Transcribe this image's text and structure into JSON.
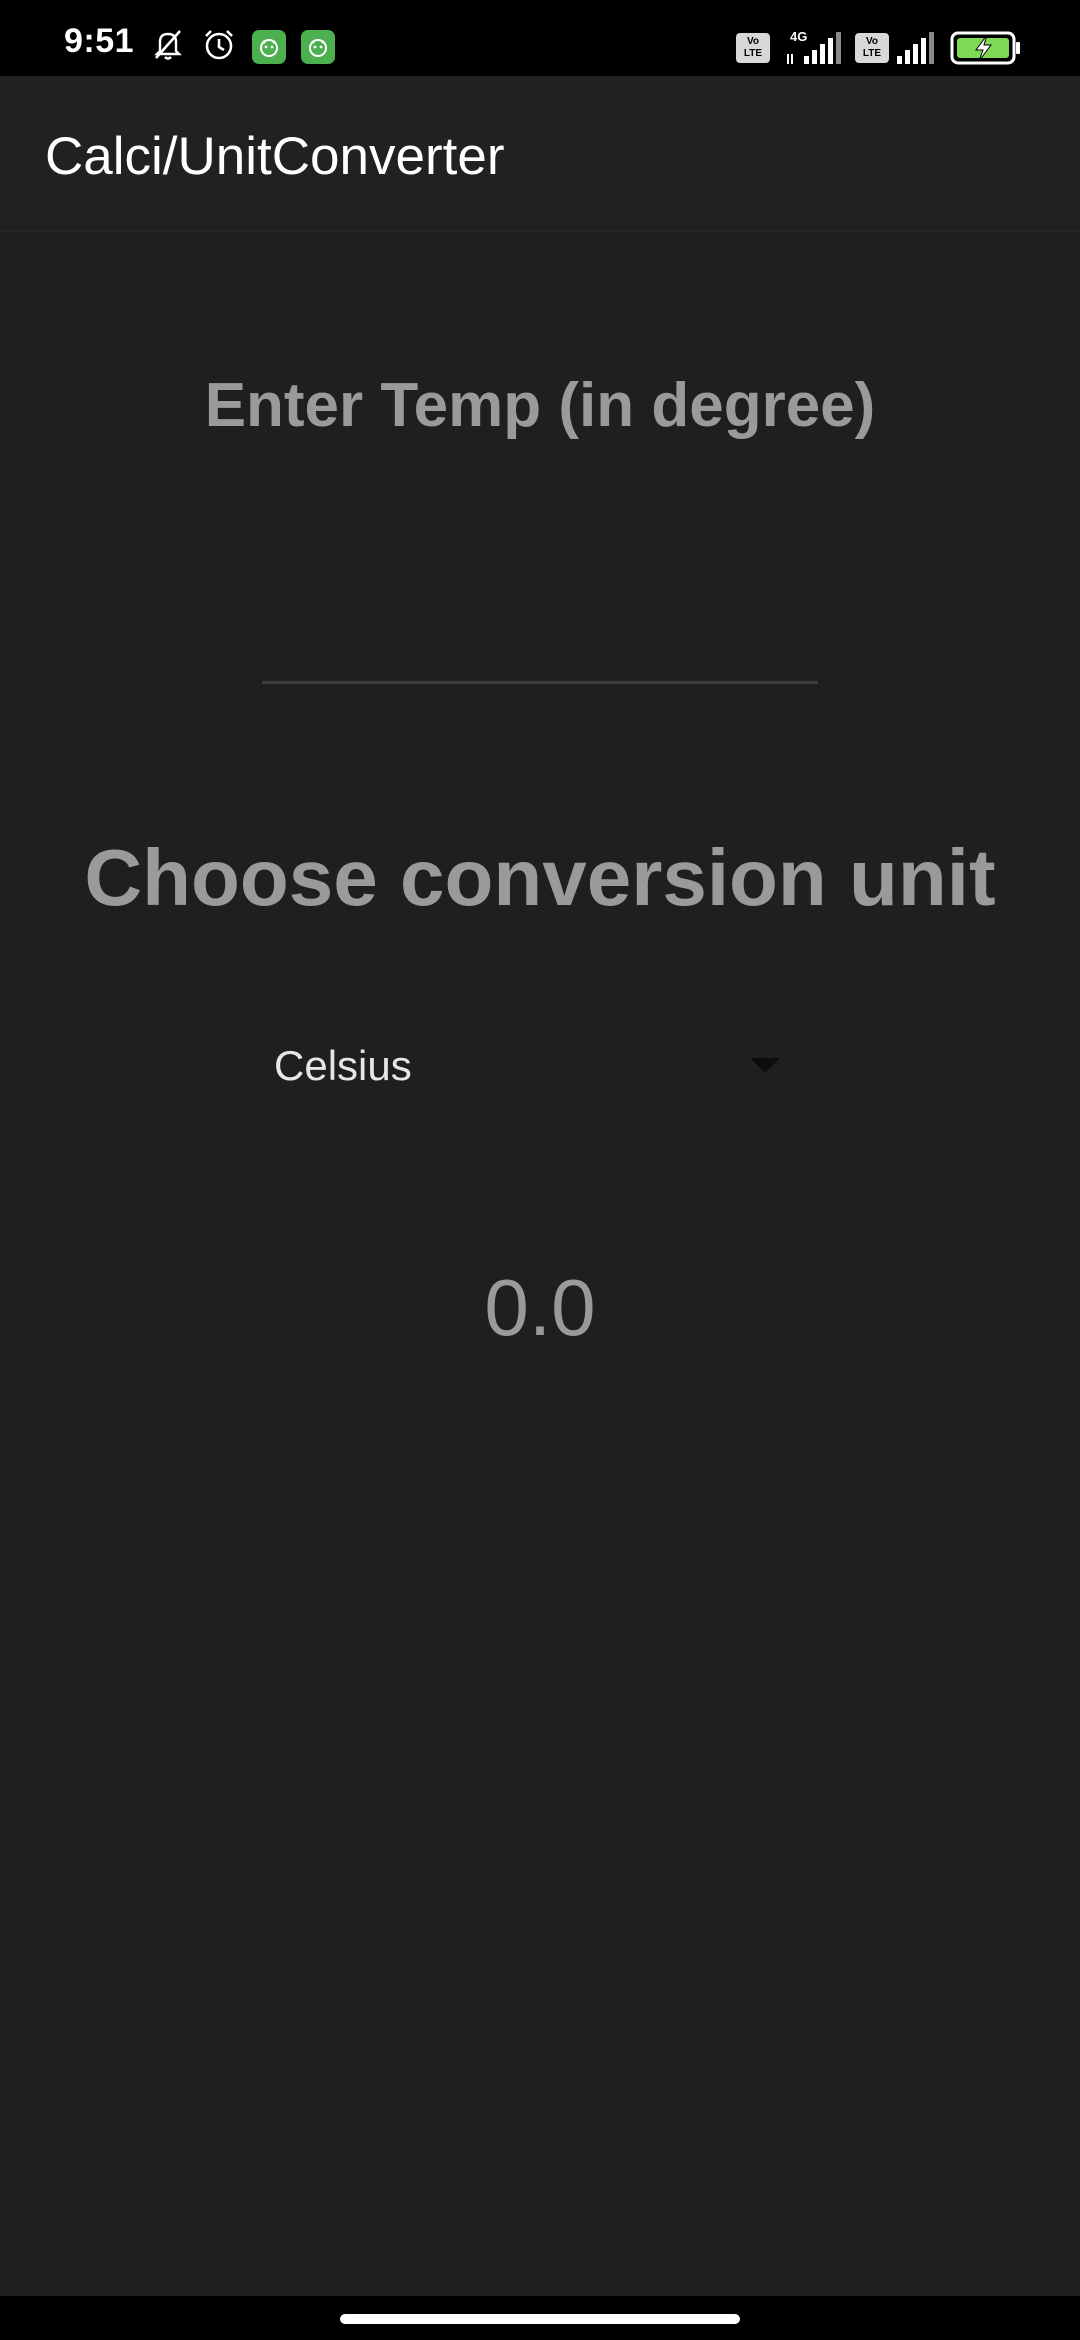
{
  "status_bar": {
    "time": "9:51",
    "icons": [
      "mute-icon",
      "alarm-icon",
      "app-notification-icon",
      "app-notification-icon",
      "volte-icon",
      "signal-4g-icon",
      "volte-icon",
      "signal-icon",
      "battery-charging-icon"
    ],
    "volte_label_top": "Vo",
    "volte_label_bottom": "LTE",
    "network_label": "4G"
  },
  "app_bar": {
    "title": "Calci/UnitConverter"
  },
  "main": {
    "enter_label": "Enter Temp (in degree)",
    "temp_input_value": "",
    "choose_label": "Choose conversion unit",
    "unit_selected": "Celsius",
    "result": "0.0"
  },
  "colors": {
    "background": "#1f1f1f",
    "app_bar": "#212121",
    "label_gray": "#9a9a9a",
    "notification_green": "#4caf50",
    "battery_green": "#7ed957"
  }
}
